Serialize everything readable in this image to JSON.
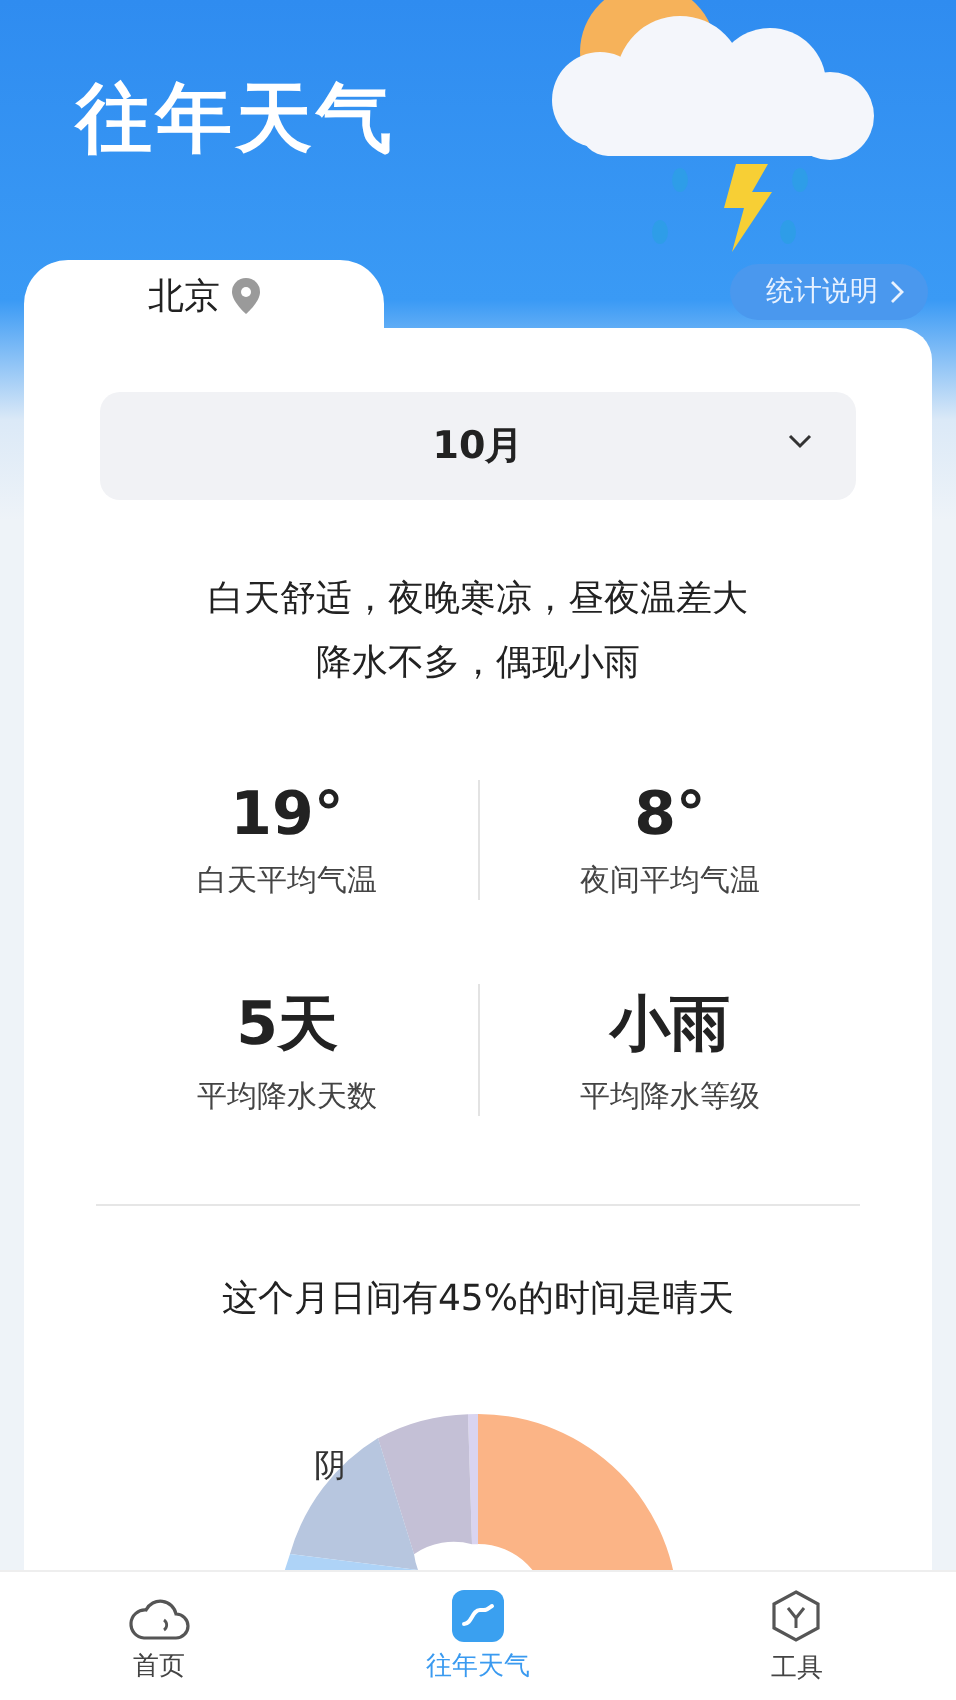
{
  "header": {
    "title": "往年天气",
    "info_button": "统计说明"
  },
  "location_tab": {
    "city": "北京"
  },
  "month_select": {
    "value": "10月"
  },
  "description": [
    "白天舒适，夜晚寒凉，昼夜温差大",
    "降水不多，偶现小雨"
  ],
  "stats": [
    {
      "value": "19°",
      "label": "白天平均气温"
    },
    {
      "value": "8°",
      "label": "夜间平均气温"
    },
    {
      "value": "5天",
      "label": "平均降水天数"
    },
    {
      "value": "小雨",
      "label": "平均降水等级"
    }
  ],
  "summary": "这个月日间有45%的时间是晴天",
  "donut": {
    "visible_label": "阴"
  },
  "nav": [
    {
      "label": "首页",
      "kind": "cloud",
      "selected": false
    },
    {
      "label": "往年天气",
      "kind": "trend",
      "selected": true
    },
    {
      "label": "工具",
      "kind": "tool",
      "selected": false
    }
  ]
}
